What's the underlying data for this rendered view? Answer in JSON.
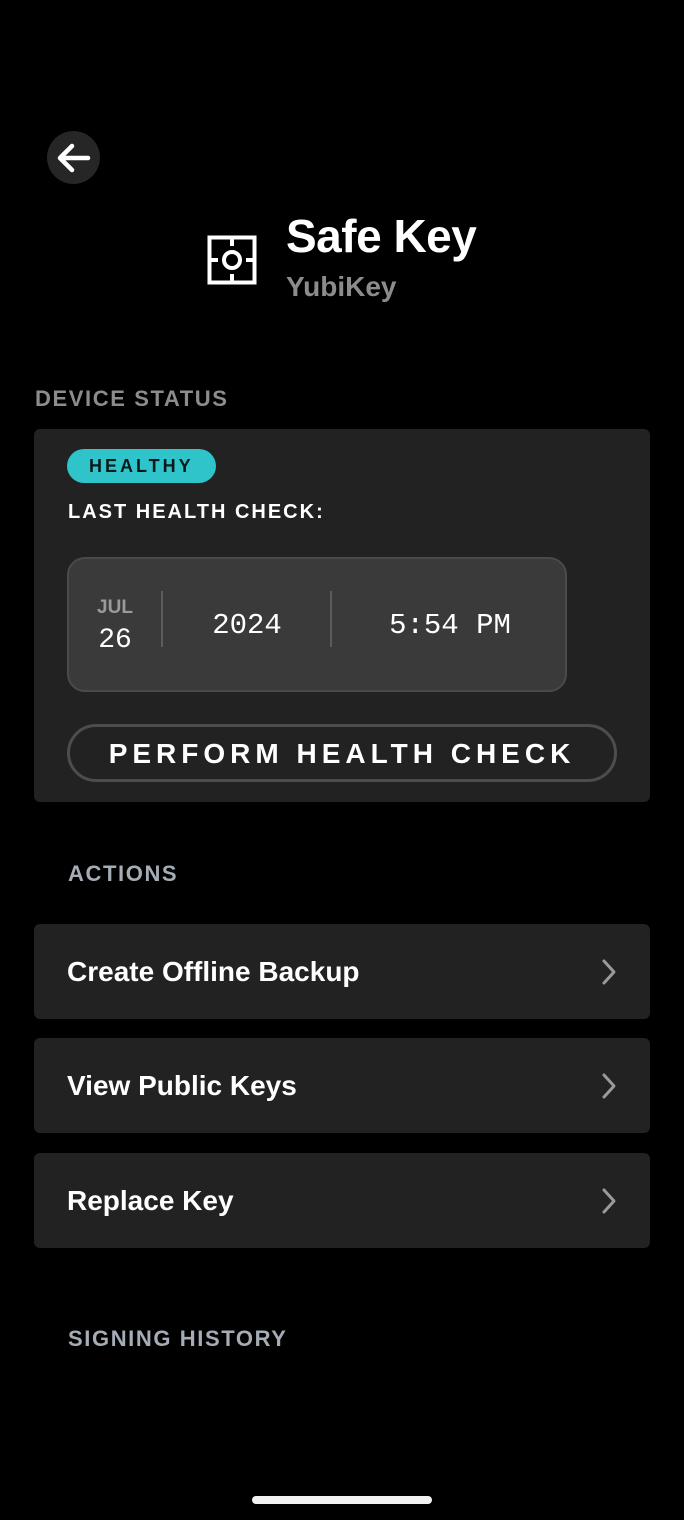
{
  "header": {
    "title": "Safe Key",
    "subtitle": "YubiKey",
    "back_icon": "arrow-left-icon",
    "device_icon": "key-device-icon"
  },
  "device_status": {
    "section_label": "DEVICE STATUS",
    "badge": "HEALTHY",
    "badge_color": "#2ec4c9",
    "last_check_label": "LAST HEALTH CHECK:",
    "last_check": {
      "month": "JUL",
      "day": "26",
      "year": "2024",
      "time": "5:54 PM"
    },
    "button_label": "PERFORM HEALTH CHECK"
  },
  "actions": {
    "section_label": "ACTIONS",
    "items": [
      {
        "label": "Create Offline Backup",
        "icon": "chevron-right-icon"
      },
      {
        "label": "View Public Keys",
        "icon": "chevron-right-icon"
      },
      {
        "label": "Replace Key",
        "icon": "chevron-right-icon"
      }
    ]
  },
  "signing_history": {
    "section_label": "SIGNING HISTORY"
  },
  "colors": {
    "background": "#000000",
    "card": "#222222",
    "accent": "#2ec4c9",
    "muted_text": "#8c8c8c"
  }
}
